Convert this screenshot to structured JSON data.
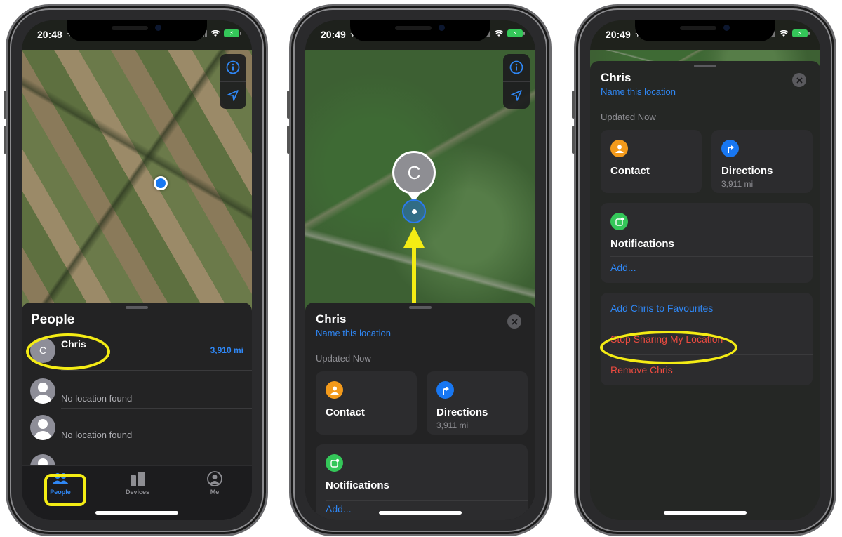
{
  "phones": [
    {
      "status": {
        "time": "20:48"
      },
      "sheet": {
        "title": "People",
        "people": [
          {
            "initial": "C",
            "name": "Chris",
            "distance": "3,910 mi"
          },
          {
            "name": "",
            "subtitle": "No location found"
          },
          {
            "name": "",
            "subtitle": "No location found"
          }
        ]
      },
      "tabs": [
        {
          "label": "People",
          "icon": "people-icon",
          "active": true
        },
        {
          "label": "Devices",
          "icon": "devices-icon",
          "active": false
        },
        {
          "label": "Me",
          "icon": "me-icon",
          "active": false
        }
      ]
    },
    {
      "status": {
        "time": "20:49"
      },
      "map_pin": {
        "initial": "C"
      },
      "sheet": {
        "title": "Chris",
        "name_location": "Name this location",
        "updated": "Updated Now",
        "contact_label": "Contact",
        "directions_label": "Directions",
        "directions_distance": "3,911 mi",
        "notifications_label": "Notifications",
        "add_label": "Add..."
      }
    },
    {
      "status": {
        "time": "20:49"
      },
      "sheet": {
        "title": "Chris",
        "name_location": "Name this location",
        "updated": "Updated Now",
        "contact_label": "Contact",
        "directions_label": "Directions",
        "directions_distance": "3,911 mi",
        "notifications_label": "Notifications",
        "add_label": "Add...",
        "actions": [
          {
            "label": "Add Chris to Favourites",
            "style": "link"
          },
          {
            "label": "Stop Sharing My Location",
            "style": "danger"
          },
          {
            "label": "Remove Chris",
            "style": "danger"
          }
        ]
      }
    }
  ],
  "colors": {
    "accent_blue": "#2f87f5",
    "danger_red": "#eb4b40",
    "highlight_yellow": "#f4ec14",
    "contact_orange": "#f39a1b",
    "notifications_green": "#34c759"
  }
}
